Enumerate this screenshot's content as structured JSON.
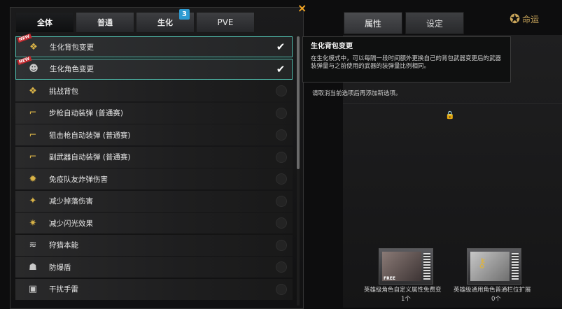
{
  "tabs": [
    {
      "label": "全体",
      "badge": ""
    },
    {
      "label": "普通",
      "badge": ""
    },
    {
      "label": "生化",
      "badge": "3"
    },
    {
      "label": "PVE",
      "badge": ""
    }
  ],
  "close_icon": "×",
  "items": [
    {
      "label": "生化背包变更",
      "icon": "backpack-icon",
      "new": true,
      "new_label": "NEW",
      "checked": true
    },
    {
      "label": "生化角色变更",
      "icon": "character-icon",
      "new": true,
      "new_label": "NEW",
      "checked": true
    },
    {
      "label": "挑战背包",
      "icon": "backpack-icon",
      "new": false,
      "checked": false
    },
    {
      "label": "步枪自动装弹 (普通赛)",
      "icon": "rifle-icon",
      "new": false,
      "checked": false
    },
    {
      "label": "狙击枪自动装弹 (普通赛)",
      "icon": "sniper-icon",
      "new": false,
      "checked": false
    },
    {
      "label": "副武器自动装弹 (普通赛)",
      "icon": "pistol-icon",
      "new": false,
      "checked": false
    },
    {
      "label": "免疫队友炸弹伤害",
      "icon": "explosion-icon",
      "new": false,
      "checked": false
    },
    {
      "label": "减少掉落伤害",
      "icon": "fall-icon",
      "new": false,
      "checked": false
    },
    {
      "label": "减少闪光效果",
      "icon": "flash-icon",
      "new": false,
      "checked": false
    },
    {
      "label": "狩猎本能",
      "icon": "claw-icon",
      "new": false,
      "checked": false
    },
    {
      "label": "防爆盾",
      "icon": "shield-icon",
      "new": false,
      "checked": false
    },
    {
      "label": "干扰手雷",
      "icon": "grenade-icon",
      "new": false,
      "checked": false
    }
  ],
  "right_tabs": {
    "attributes": "属性",
    "settings": "设定"
  },
  "logo": "命运",
  "tooltip": {
    "title": "生化背包变更",
    "body": "在生化模式中，可以每隔一段时间额外更换自己的背包武器变更后的武器装弹量与之前使用的武器的装弹量比例相同。"
  },
  "notice": "请取消当前选项后再添加新选项。",
  "cards": [
    {
      "label": "英雄级角色自定义属性免费变",
      "count": "1个",
      "free_label": "FREE"
    },
    {
      "label": "英雄级通用角色普通栏位扩展",
      "count": "0个"
    }
  ]
}
